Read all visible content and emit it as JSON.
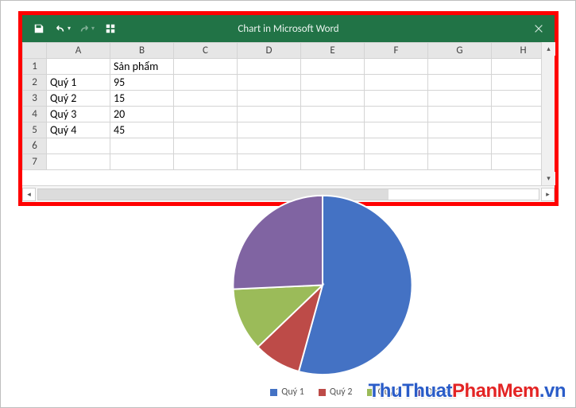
{
  "window": {
    "title": "Chart in Microsoft Word"
  },
  "qat": {
    "save": "save-icon",
    "undo": "undo-icon",
    "redo": "redo-icon",
    "customize": "customize-icon"
  },
  "sheet": {
    "columns": [
      "A",
      "B",
      "C",
      "D",
      "E",
      "F",
      "G",
      "H"
    ],
    "rows": [
      "1",
      "2",
      "3",
      "4",
      "5",
      "6",
      "7"
    ],
    "cells": {
      "B1": "Sản phẩm",
      "A2": "Quý 1",
      "B2": "95",
      "A3": "Quý 2",
      "B3": "15",
      "A4": "Quý 3",
      "B4": "20",
      "A5": "Quý 4",
      "B5": "45"
    }
  },
  "chart_data": {
    "type": "pie",
    "categories": [
      "Quý 1",
      "Quý 2",
      "Quý 3",
      "Quý 4"
    ],
    "values": [
      95,
      15,
      20,
      45
    ],
    "series_name": "Sản phẩm",
    "colors": [
      "#4472c4",
      "#bd4b48",
      "#9bbb59",
      "#8064a2"
    ],
    "legend_position": "bottom"
  },
  "legend": {
    "items": [
      {
        "label": "Quý 1",
        "color": "#4472c4"
      },
      {
        "label": "Quý 2",
        "color": "#bd4b48"
      },
      {
        "label": "Quý 3",
        "color": "#9bbb59"
      },
      {
        "label": "Quý 4",
        "color": "#8064a2"
      }
    ]
  },
  "watermark": {
    "part1": "ThuThuat",
    "part2": "PhanMem",
    "suffix": ".vn"
  }
}
